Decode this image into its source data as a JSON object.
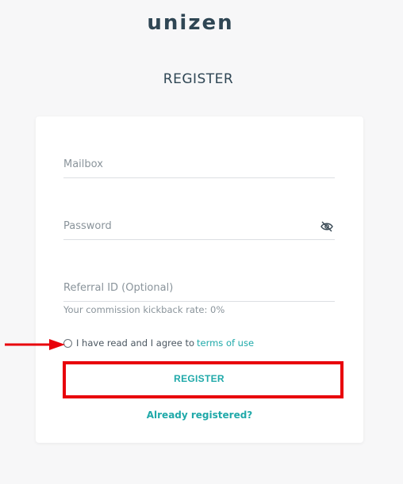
{
  "logo": {
    "text": "unizen"
  },
  "page_title": "REGISTER",
  "form": {
    "mailbox": {
      "placeholder": "Mailbox",
      "value": ""
    },
    "password": {
      "placeholder": "Password",
      "value": ""
    },
    "referral": {
      "placeholder": "Referral ID (Optional)",
      "value": ""
    },
    "commission_hint": "Your commission kickback rate: 0%",
    "agree_text": "I have read and I agree to",
    "terms_link": "terms of use",
    "register_label": "REGISTER",
    "already_registered": "Already registered?"
  },
  "annotations": {
    "highlight_color": "#e8000b"
  },
  "colors": {
    "accent": "#1fa9a9",
    "background": "#f7f7f8"
  },
  "icons": {
    "password_toggle": "eye-slash-icon"
  }
}
